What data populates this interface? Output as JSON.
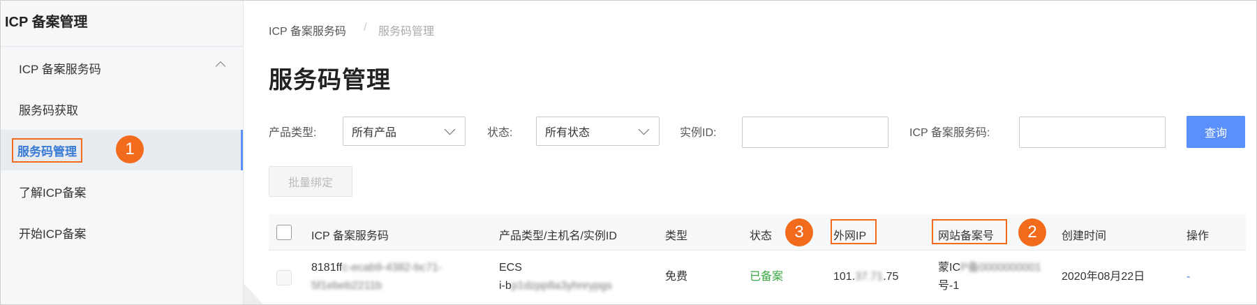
{
  "sidebar": {
    "title": "ICP 备案管理",
    "group_label": "ICP 备案服务码",
    "items": [
      {
        "label": "服务码获取"
      },
      {
        "label": "服务码管理"
      },
      {
        "label": "了解ICP备案"
      },
      {
        "label": "开始ICP备案"
      }
    ]
  },
  "breadcrumb": {
    "parent": "ICP 备案服务码",
    "separator": "/",
    "current": "服务码管理"
  },
  "page": {
    "title": "服务码管理"
  },
  "filters": {
    "product_type_label": "产品类型:",
    "product_type_value": "所有产品",
    "status_label": "状态:",
    "status_value": "所有状态",
    "instance_id_label": "实例ID:",
    "instance_id_value": "",
    "icp_code_label": "ICP 备案服务码:",
    "icp_code_value": "",
    "query_button": "查询"
  },
  "actions": {
    "batch_bind": "批量绑定"
  },
  "table": {
    "headers": [
      "ICP 备案服务码",
      "产品类型/主机名/实例ID",
      "类型",
      "状态",
      "外网IP",
      "网站备案号",
      "创建时间",
      "操作"
    ],
    "rows": [
      {
        "code_line1_visible": "8181ff",
        "code_line1_blurred": "c-ecab9-4382-bc71-",
        "code_line2_blurred": "5f1ebeb2211b",
        "product_line1": "ECS",
        "product_line2_visible": "i-b",
        "product_line2_blurred": "p1dzpp8a3yhnrypgs",
        "type": "免费",
        "status": "已备案",
        "ip_prefix": "101.",
        "ip_blurred": "37.71",
        "ip_suffix": ".75",
        "record_visible": "蒙IC",
        "record_blurred": "P备0000000001",
        "record_line2": "号-1",
        "created": "2020年08月22日",
        "action": "-"
      }
    ]
  },
  "annotations": {
    "badge1": "1",
    "badge2": "2",
    "badge3": "3"
  },
  "colors": {
    "accent": "#5b8ff9",
    "annotation": "#f26b1d",
    "status_ok": "#3aa843"
  }
}
